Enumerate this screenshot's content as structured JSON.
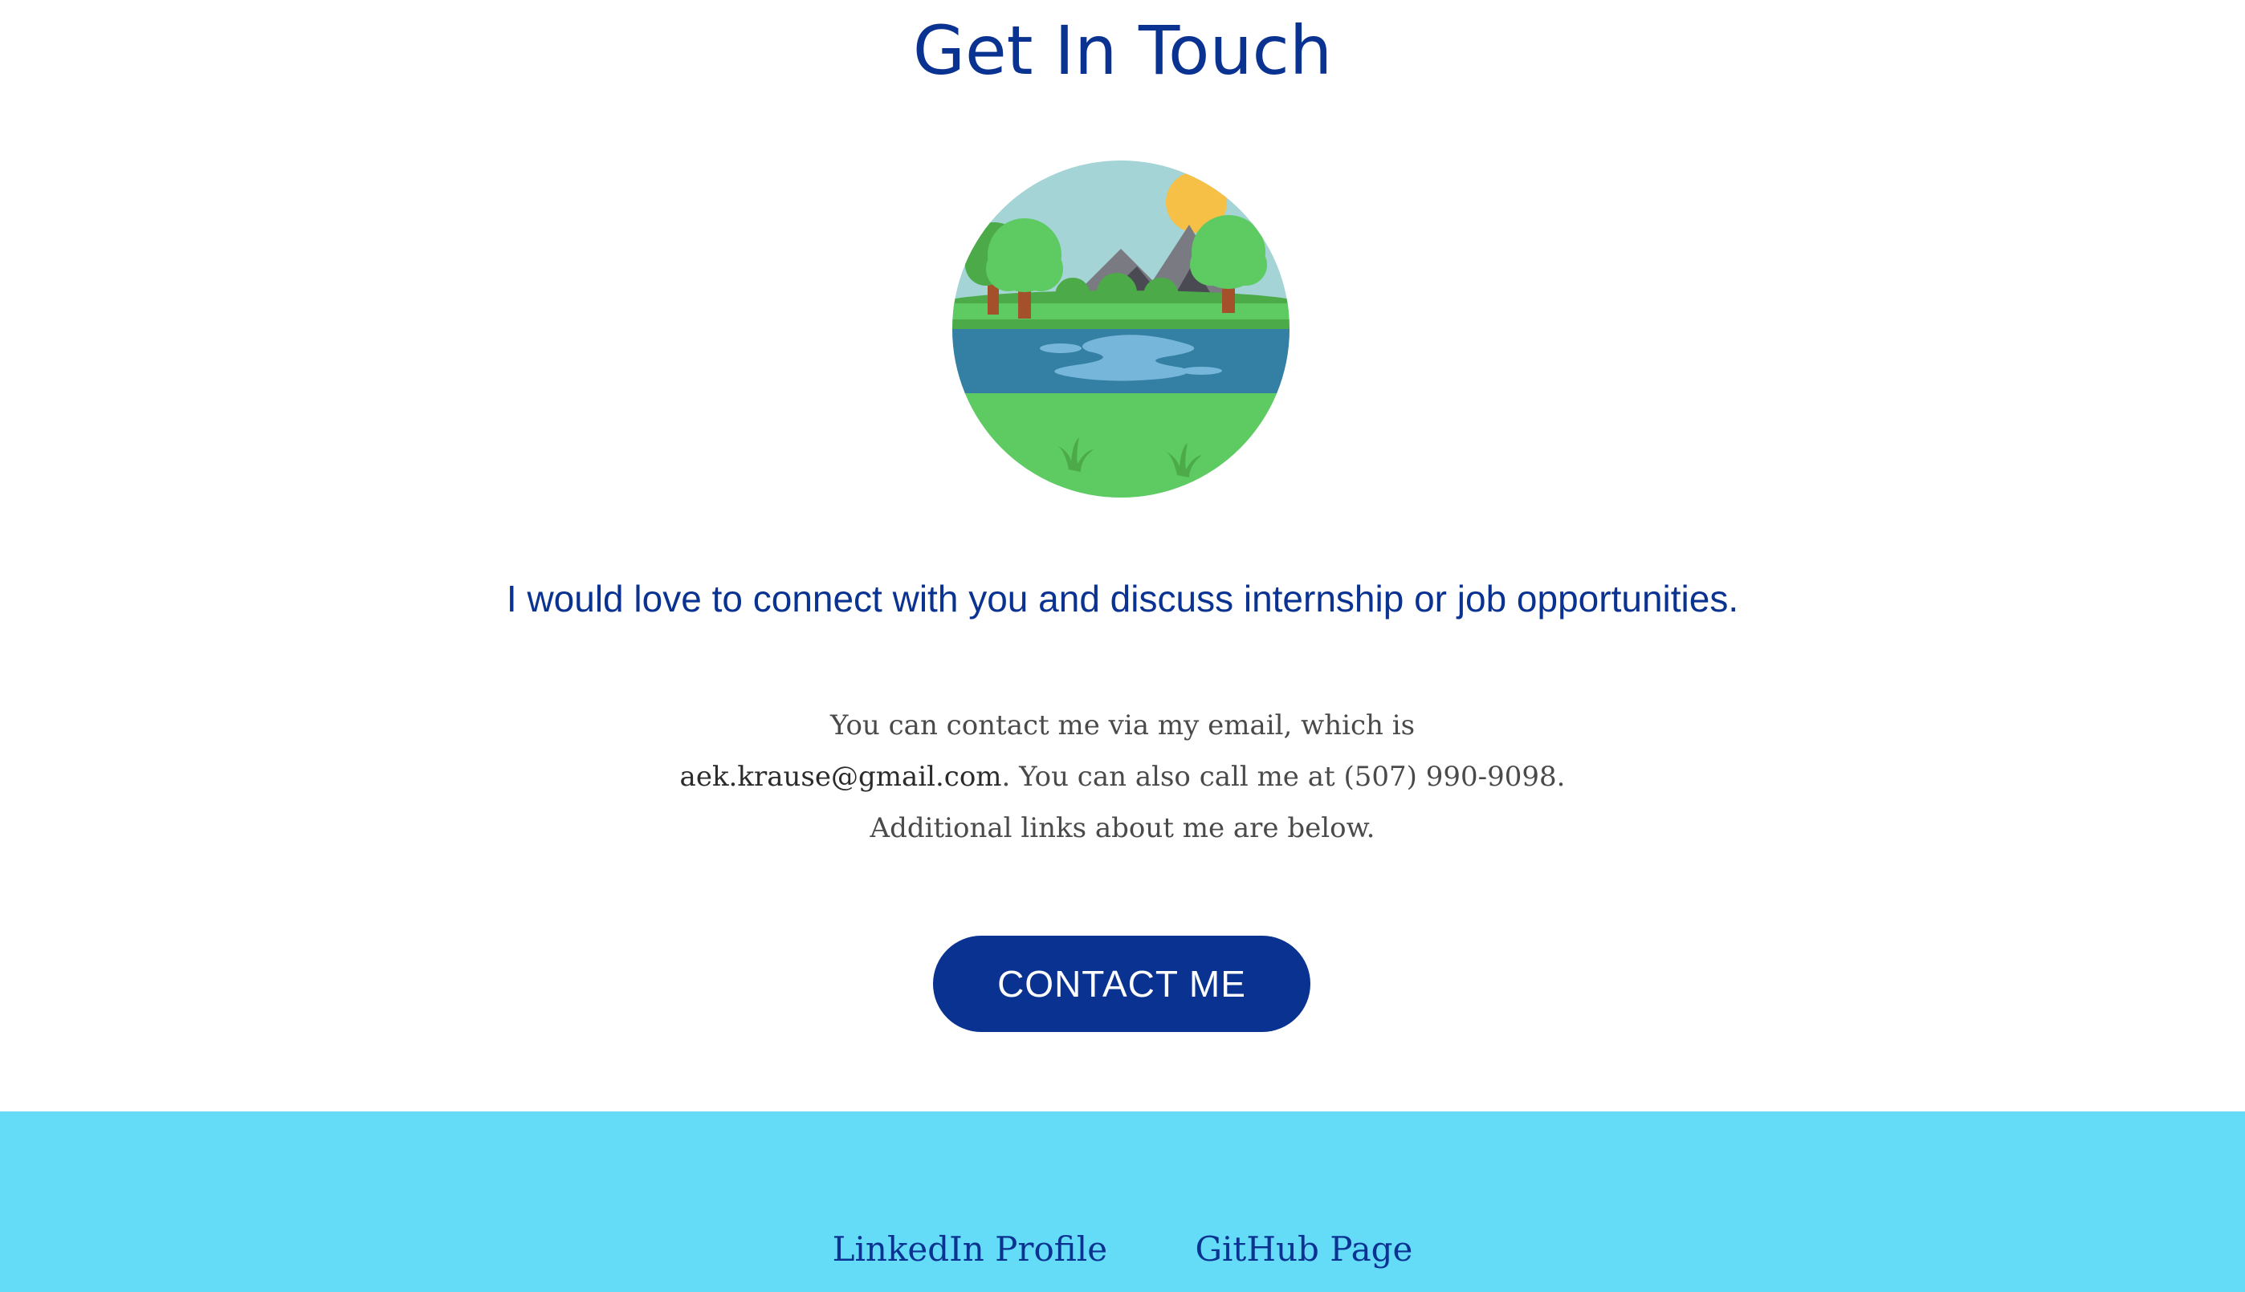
{
  "contact": {
    "title": "Get In Touch",
    "tagline": "I would love to connect with you and discuss internship or job opportunities.",
    "info_prefix": "You can contact me via my email, which is ",
    "email": "aek.krause@gmail.com",
    "info_suffix": ". You can also call me at (507) 990-9098. Additional links about me are below.",
    "button_label": "CONTACT ME",
    "illustration_icon": "landscape-illustration"
  },
  "footer": {
    "links": [
      {
        "label": "LinkedIn Profile"
      },
      {
        "label": "GitHub Page"
      }
    ]
  },
  "colors": {
    "accent": "#0a3291",
    "footer_bg": "#64dcf8",
    "body_text": "#4a4a4a"
  }
}
